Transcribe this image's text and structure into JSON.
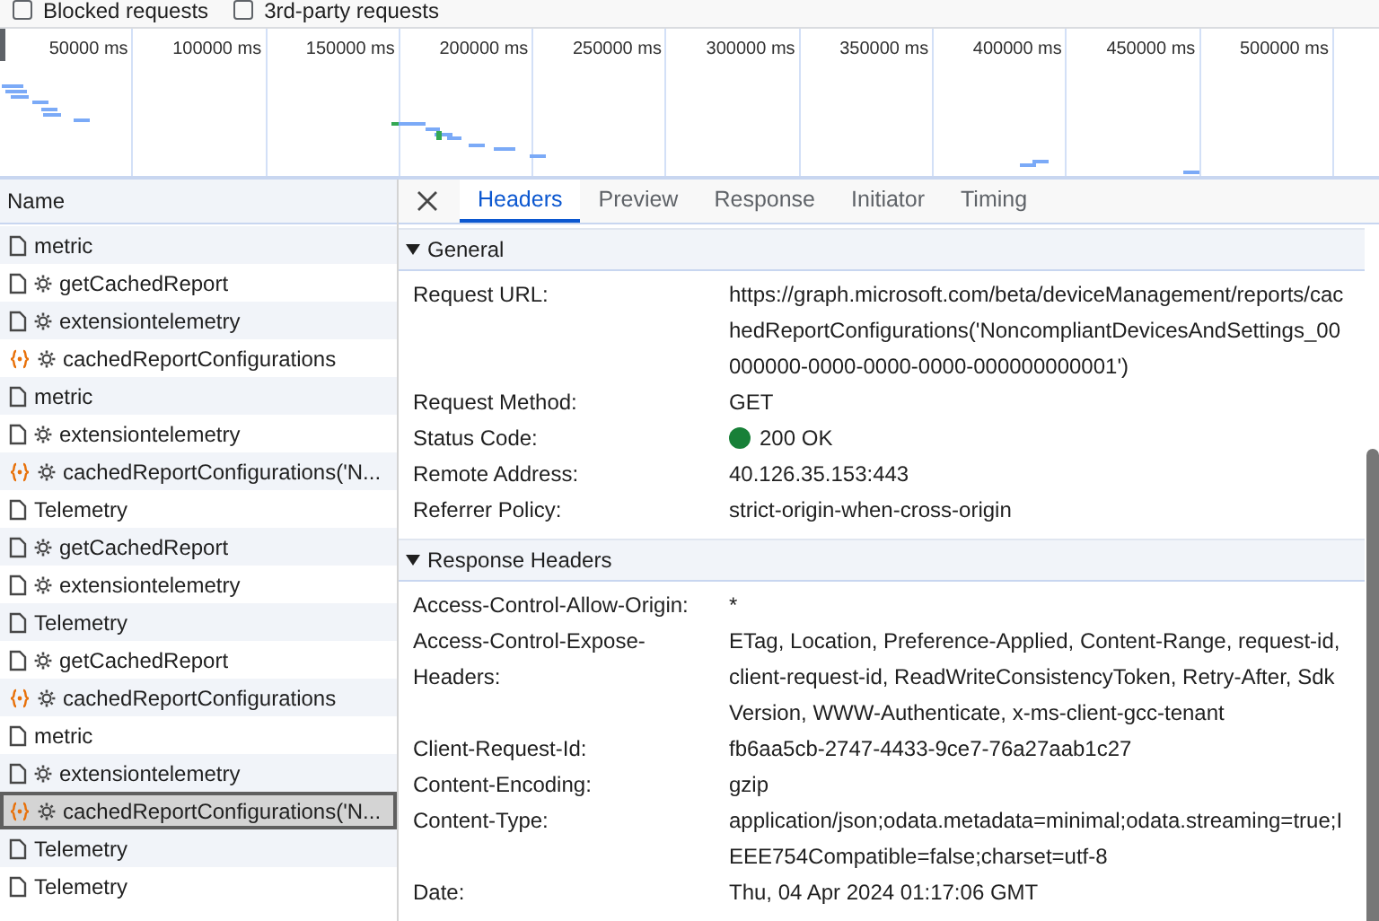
{
  "filters": [
    {
      "label": "Blocked requests",
      "checked": false
    },
    {
      "label": "3rd-party requests",
      "checked": false
    }
  ],
  "overview": {
    "ticks": [
      "50000 ms",
      "100000 ms",
      "150000 ms",
      "200000 ms",
      "250000 ms",
      "300000 ms",
      "350000 ms",
      "400000 ms",
      "450000 ms",
      "500000 ms"
    ]
  },
  "request_list": {
    "column": "Name",
    "rows": [
      {
        "name": "metric",
        "kind": "document",
        "gear": false,
        "selected": false
      },
      {
        "name": "getCachedReport",
        "kind": "document",
        "gear": true,
        "selected": false
      },
      {
        "name": "extensiontelemetry",
        "kind": "document",
        "gear": true,
        "selected": false
      },
      {
        "name": "cachedReportConfigurations",
        "kind": "json",
        "gear": true,
        "selected": false
      },
      {
        "name": "metric",
        "kind": "document",
        "gear": false,
        "selected": false
      },
      {
        "name": "extensiontelemetry",
        "kind": "document",
        "gear": true,
        "selected": false
      },
      {
        "name": "cachedReportConfigurations('N...",
        "kind": "json",
        "gear": true,
        "selected": false
      },
      {
        "name": "Telemetry",
        "kind": "document",
        "gear": false,
        "selected": false
      },
      {
        "name": "getCachedReport",
        "kind": "document",
        "gear": true,
        "selected": false
      },
      {
        "name": "extensiontelemetry",
        "kind": "document",
        "gear": true,
        "selected": false
      },
      {
        "name": "Telemetry",
        "kind": "document",
        "gear": false,
        "selected": false
      },
      {
        "name": "getCachedReport",
        "kind": "document",
        "gear": true,
        "selected": false
      },
      {
        "name": "cachedReportConfigurations",
        "kind": "json",
        "gear": true,
        "selected": false
      },
      {
        "name": "metric",
        "kind": "document",
        "gear": false,
        "selected": false
      },
      {
        "name": "extensiontelemetry",
        "kind": "document",
        "gear": true,
        "selected": false
      },
      {
        "name": "cachedReportConfigurations('N...",
        "kind": "json",
        "gear": true,
        "selected": true
      },
      {
        "name": "Telemetry",
        "kind": "document",
        "gear": false,
        "selected": false
      },
      {
        "name": "Telemetry",
        "kind": "document",
        "gear": false,
        "selected": false
      }
    ]
  },
  "details": {
    "tabs": [
      {
        "label": "Headers",
        "selected": true
      },
      {
        "label": "Preview",
        "selected": false
      },
      {
        "label": "Response",
        "selected": false
      },
      {
        "label": "Initiator",
        "selected": false
      },
      {
        "label": "Timing",
        "selected": false
      }
    ],
    "sections": [
      {
        "title": "General",
        "expanded": true,
        "rows": [
          {
            "name": "Request URL:",
            "value": "https://graph.microsoft.com/beta/deviceManagement/reports/cachedReportConfigurations('NoncompliantDevicesAndSettings_00000000-0000-0000-0000-000000000001')"
          },
          {
            "name": "Request Method:",
            "value": "GET"
          },
          {
            "name": "Status Code:",
            "value": "200 OK",
            "color": "#188038"
          },
          {
            "name": "Remote Address:",
            "value": "40.126.35.153:443"
          },
          {
            "name": "Referrer Policy:",
            "value": "strict-origin-when-cross-origin"
          }
        ]
      },
      {
        "title": "Response Headers",
        "expanded": true,
        "rows": [
          {
            "name": "Access-Control-Allow-Origin:",
            "value": "*"
          },
          {
            "name": "Access-Control-Expose-Headers:",
            "value": "ETag, Location, Preference-Applied, Content-Range, request-id, client-request-id, ReadWriteConsistencyToken, Retry-After, SdkVersion, WWW-Authenticate, x-ms-client-gcc-tenant"
          },
          {
            "name": "Client-Request-Id:",
            "value": "fb6aa5cb-2747-4433-9ce7-76a27aab1c27"
          },
          {
            "name": "Content-Encoding:",
            "value": "gzip"
          },
          {
            "name": "Content-Type:",
            "value": "application/json;odata.metadata=minimal;odata.streaming=true;IEEE754Compatible=false;charset=utf-8"
          },
          {
            "name": "Date:",
            "value": "Thu, 04 Apr 2024 01:17:06 GMT"
          }
        ]
      }
    ]
  }
}
